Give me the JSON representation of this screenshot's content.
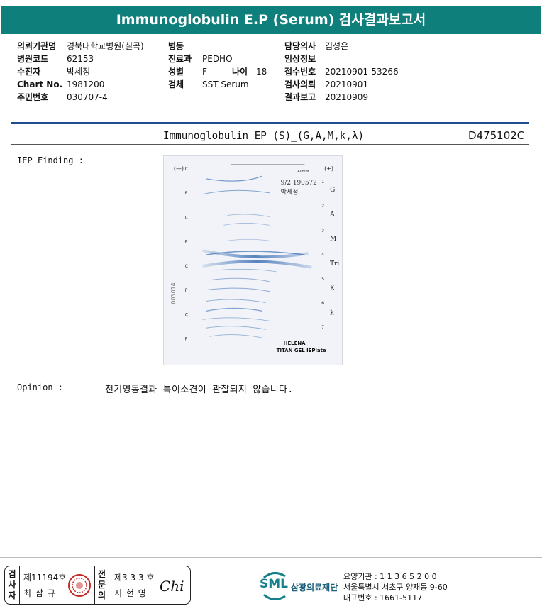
{
  "header": {
    "title": "Immunoglobulin E.P (Serum) 검사결과보고서"
  },
  "patient": {
    "institution": {
      "label": "의뢰기관명",
      "value": "경북대학교병원(칠곡)"
    },
    "hospital_code": {
      "label": "병원코드",
      "value": "62153"
    },
    "examinee": {
      "label": "수진자",
      "value": "박세정"
    },
    "chart_no": {
      "label": "Chart No.",
      "value": "1981200"
    },
    "resident_no": {
      "label": "주민번호",
      "value": "030707-4"
    },
    "ward": {
      "label": "병동",
      "value": ""
    },
    "department": {
      "label": "진료과",
      "value": "PEDHO"
    },
    "sex": {
      "label": "성별",
      "value": "F"
    },
    "age": {
      "label": "나이",
      "value": "18"
    },
    "specimen": {
      "label": "검체",
      "value": "SST Serum"
    },
    "doctor": {
      "label": "담당의사",
      "value": "김성은"
    },
    "clinical_info": {
      "label": "임상정보",
      "value": ""
    },
    "receipt_no": {
      "label": "접수번호",
      "value": "20210901-53266"
    },
    "requested": {
      "label": "검사의뢰",
      "value": "20210901"
    },
    "reported": {
      "label": "결과보고",
      "value": "20210909"
    }
  },
  "test": {
    "name": "Immunoglobulin EP (S)_(G,A,M,k,λ)",
    "code": "D475102C",
    "iep_label": "IEP Finding :",
    "opinion_label": "Opinion :",
    "opinion_text": "전기영동결과 특이소견이 관찰되지 않습니다."
  },
  "gel": {
    "polarity_neg": "(—)",
    "polarity_pos": "(+)",
    "scale": "40mm",
    "note_date": "9/2 190572",
    "note_name": "박세정",
    "side_number": "003014",
    "left_marks": [
      "C",
      "P",
      "C",
      "P",
      "C",
      "P",
      "C",
      "P"
    ],
    "right_numbers": [
      "1",
      "2",
      "3",
      "4",
      "5",
      "6",
      "7"
    ],
    "right_letters": [
      "G",
      "A",
      "M",
      "Tri",
      "K",
      "λ"
    ],
    "brand": "HELENA",
    "product": "TITAN GEL IEPlate"
  },
  "footer": {
    "examiner_label": "검사자",
    "examiner_license": "제11194호",
    "examiner_name": "최 삼 규",
    "specialist_label": "전문의",
    "specialist_license": "제3 3 3 호",
    "specialist_name": "지 현 영",
    "signature": "Chi",
    "org_logo": "SML",
    "org_name": "삼광의료재단",
    "care_institution": "요양기관 : 1 1 3 6 5 2 0 0",
    "address": "서울특별시 서초구 양재동 9-60",
    "phone": "대표번호 : 1661-5117"
  },
  "colors": {
    "title_bg": "#0e7f7a",
    "rule": "#1e4f8c",
    "band": "#3b6fb5"
  }
}
